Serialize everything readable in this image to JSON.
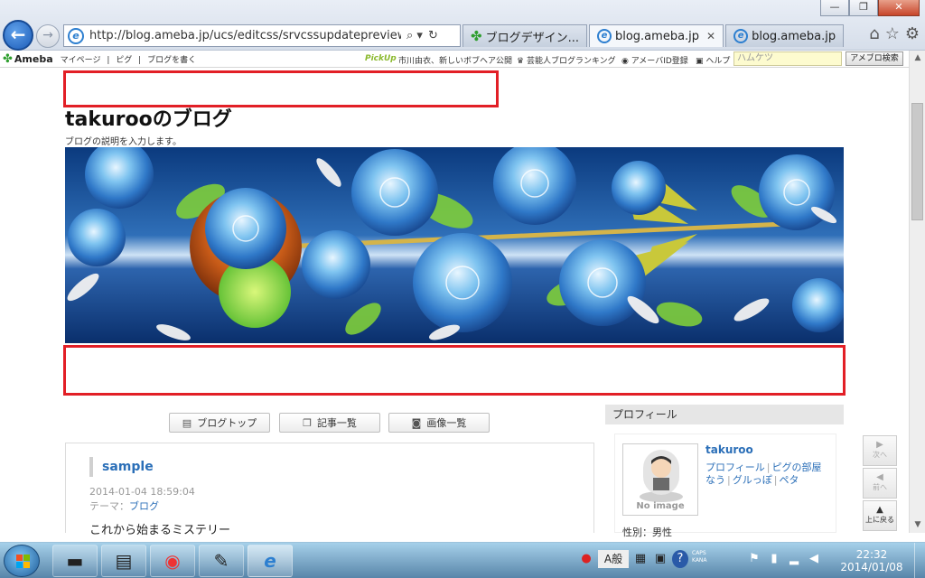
{
  "window": {
    "minimize_label": "—",
    "maximize_label": "❐",
    "close_label": "✕"
  },
  "browser": {
    "address": "http://blog.ameba.jp/ucs/editcss/srvcssupdatepreview.do",
    "search_glyph": "⌕ ▾",
    "refresh_glyph": "↻",
    "tabs": [
      {
        "label": "ブログデザイン...",
        "icon": "ameba-clover-icon"
      },
      {
        "label": "blog.ameba.jp",
        "icon": "ie-icon",
        "close": "✕"
      },
      {
        "label": "blog.ameba.jp",
        "icon": "ie-icon"
      }
    ],
    "home_glyph": "⌂",
    "favorites_glyph": "☆",
    "tools_glyph": "⚙"
  },
  "ameba_bar": {
    "logo": "Ameba",
    "links": [
      "マイページ",
      "|",
      "ピグ",
      "|",
      "ブログを書く"
    ],
    "pickup_label": "PickUp",
    "pickup_text": "市川由衣、新しいボブヘア公開",
    "ranking": "芸能人ブログランキング",
    "amebaid": "アメーバID登録",
    "help": "ヘルプ",
    "search_placeholder": "ハムケツ",
    "search_button": "アメブロ検索"
  },
  "blog": {
    "title": "takurooのブログ",
    "description": "ブログの説明を入力します。"
  },
  "nav_buttons": [
    "ブログトップ",
    "記事一覧",
    "画像一覧"
  ],
  "article": {
    "title": "sample",
    "date": "2014-01-04 18:59:04",
    "theme_label": "テーマ：",
    "theme_link": "ブログ",
    "body": "これから始まるミステリー"
  },
  "sidebar": {
    "heading": "プロフィール",
    "name": "takuroo",
    "links_row1": [
      "プロフィール",
      "ピグの部屋"
    ],
    "links_row2": [
      "なう",
      "グルっぽ",
      "ペタ"
    ],
    "no_image": "No image",
    "gender": "性別：男性"
  },
  "pager": {
    "next": "次へ",
    "prev": "前へ",
    "top": "上に戻る"
  },
  "taskbar": {
    "time": "22:32",
    "date": "2014/01/08",
    "caps": "CAPS",
    "kana": "KANA",
    "ime": "A般"
  },
  "colors": {
    "highlight_border": "#e21f26",
    "link_blue": "#2b6fb8",
    "header_bg": "#0d3f86"
  }
}
